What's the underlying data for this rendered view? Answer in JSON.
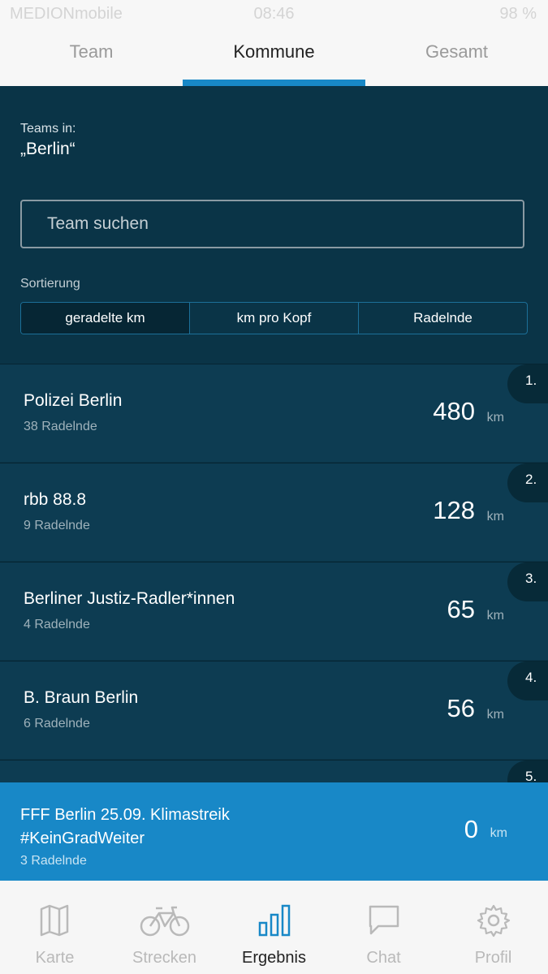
{
  "status_bar": {
    "carrier": "MEDIONmobile",
    "time": "08:46",
    "battery": "98 %"
  },
  "tabs": [
    {
      "label": "Team"
    },
    {
      "label": "Kommune"
    },
    {
      "label": "Gesamt"
    }
  ],
  "active_tab": "Kommune",
  "header": {
    "teams_in_label": "Teams in:",
    "city": "„Berlin“"
  },
  "search": {
    "placeholder": "Team suchen",
    "value": ""
  },
  "sort": {
    "label": "Sortierung",
    "options": [
      "geradelte km",
      "km pro Kopf",
      "Radelnde"
    ],
    "selected": "geradelte km"
  },
  "teams": [
    {
      "rank": "1.",
      "name": "Polizei Berlin",
      "members": "38 Radelnde",
      "km": "480",
      "unit": "km"
    },
    {
      "rank": "2.",
      "name": "rbb 88.8",
      "members": "9 Radelnde",
      "km": "128",
      "unit": "km"
    },
    {
      "rank": "3.",
      "name": "Berliner Justiz-Radler*innen",
      "members": "4 Radelnde",
      "km": "65",
      "unit": "km"
    },
    {
      "rank": "4.",
      "name": "B. Braun Berlin",
      "members": "6 Radelnde",
      "km": "56",
      "unit": "km"
    },
    {
      "rank": "5.",
      "name": "",
      "members": "",
      "km": "",
      "unit": ""
    }
  ],
  "own_team": {
    "name_line1": "FFF Berlin 25.09. Klimastreik",
    "name_line2": "#KeinGradWeiter",
    "members": "3 Radelnde",
    "km": "0",
    "unit": "km"
  },
  "bottom_nav": [
    {
      "label": "Karte",
      "icon": "map-icon"
    },
    {
      "label": "Strecken",
      "icon": "bicycle-icon"
    },
    {
      "label": "Ergebnis",
      "icon": "bar-chart-icon"
    },
    {
      "label": "Chat",
      "icon": "chat-icon"
    },
    {
      "label": "Profil",
      "icon": "gear-icon"
    }
  ],
  "active_nav": "Ergebnis",
  "colors": {
    "accent": "#1888c7",
    "panel": "#0a3447",
    "row": "#0d3c52",
    "own_team_bg": "#1888c7"
  }
}
